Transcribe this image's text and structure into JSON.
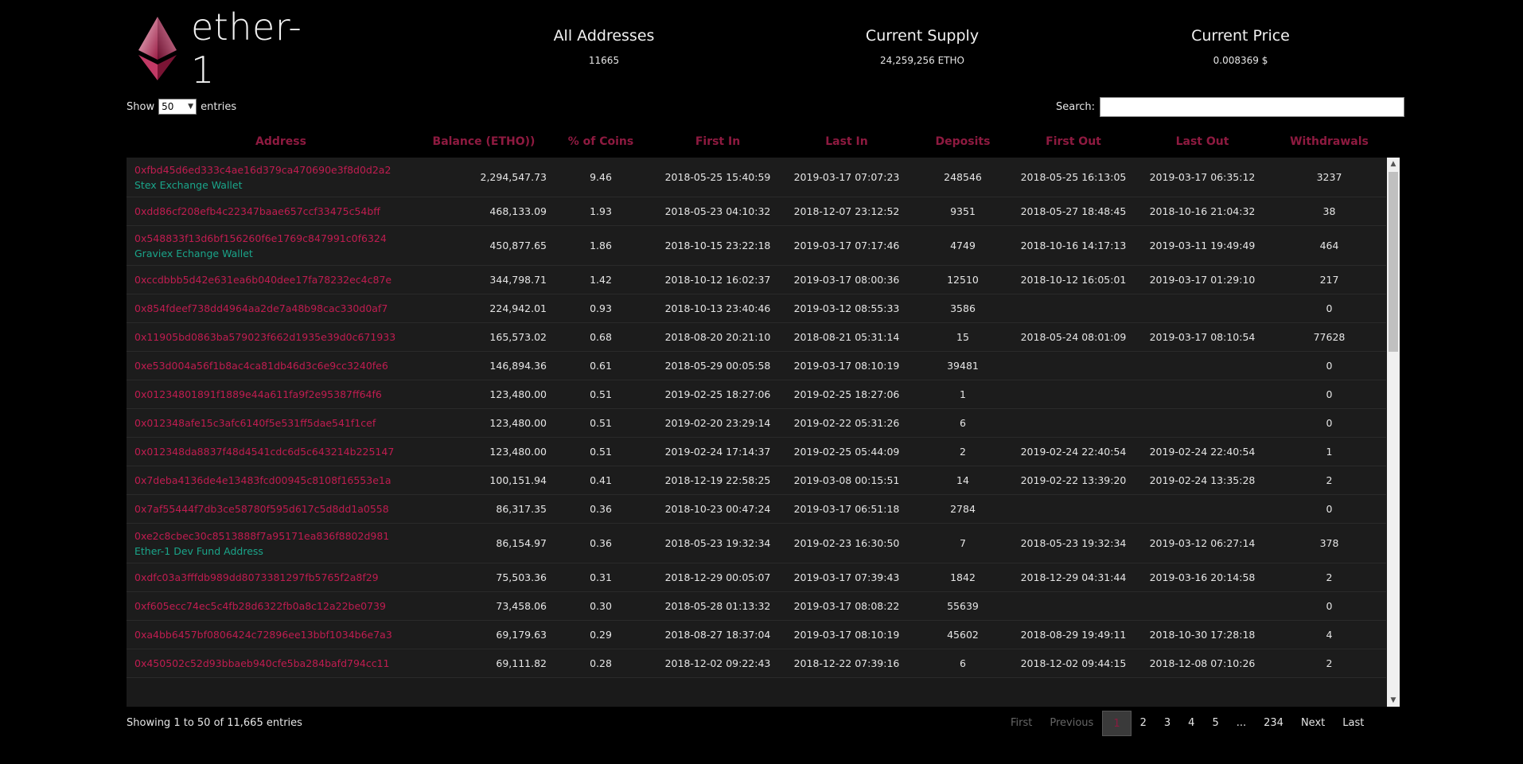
{
  "header": {
    "logo_text": "ether-1",
    "stats": [
      {
        "title": "All Addresses",
        "value": "11665"
      },
      {
        "title": "Current Supply",
        "value": "24,259,256 ETHO"
      },
      {
        "title": "Current Price",
        "value": "0.008369 $"
      }
    ]
  },
  "controls": {
    "show_label": "Show",
    "page_size": "50",
    "entries_label": "entries",
    "search_label": "Search:",
    "search_value": ""
  },
  "table": {
    "columns": [
      "Address",
      "Balance (ETHO))",
      "% of Coins",
      "First In",
      "Last In",
      "Deposits",
      "First Out",
      "Last Out",
      "Withdrawals"
    ],
    "rows": [
      {
        "address": "0xfbd45d6ed333c4ae16d379ca470690e3f8d0d2a2",
        "tag": "Stex Exchange Wallet",
        "balance": "2,294,547.73",
        "pct": "9.46",
        "first_in": "2018-05-25 15:40:59",
        "last_in": "2019-03-17 07:07:23",
        "deposits": "248546",
        "first_out": "2018-05-25 16:13:05",
        "last_out": "2019-03-17 06:35:12",
        "withdrawals": "3237"
      },
      {
        "address": "0xdd86cf208efb4c22347baae657ccf33475c54bff",
        "tag": "",
        "balance": "468,133.09",
        "pct": "1.93",
        "first_in": "2018-05-23 04:10:32",
        "last_in": "2018-12-07 23:12:52",
        "deposits": "9351",
        "first_out": "2018-05-27 18:48:45",
        "last_out": "2018-10-16 21:04:32",
        "withdrawals": "38"
      },
      {
        "address": "0x548833f13d6bf156260f6e1769c847991c0f6324",
        "tag": "Graviex Echange Wallet",
        "balance": "450,877.65",
        "pct": "1.86",
        "first_in": "2018-10-15 23:22:18",
        "last_in": "2019-03-17 07:17:46",
        "deposits": "4749",
        "first_out": "2018-10-16 14:17:13",
        "last_out": "2019-03-11 19:49:49",
        "withdrawals": "464"
      },
      {
        "address": "0xccdbbb5d42e631ea6b040dee17fa78232ec4c87e",
        "tag": "",
        "balance": "344,798.71",
        "pct": "1.42",
        "first_in": "2018-10-12 16:02:37",
        "last_in": "2019-03-17 08:00:36",
        "deposits": "12510",
        "first_out": "2018-10-12 16:05:01",
        "last_out": "2019-03-17 01:29:10",
        "withdrawals": "217"
      },
      {
        "address": "0x854fdeef738dd4964aa2de7a48b98cac330d0af7",
        "tag": "",
        "balance": "224,942.01",
        "pct": "0.93",
        "first_in": "2018-10-13 23:40:46",
        "last_in": "2019-03-12 08:55:33",
        "deposits": "3586",
        "first_out": "",
        "last_out": "",
        "withdrawals": "0"
      },
      {
        "address": "0x11905bd0863ba579023f662d1935e39d0c671933",
        "tag": "",
        "balance": "165,573.02",
        "pct": "0.68",
        "first_in": "2018-08-20 20:21:10",
        "last_in": "2018-08-21 05:31:14",
        "deposits": "15",
        "first_out": "2018-05-24 08:01:09",
        "last_out": "2019-03-17 08:10:54",
        "withdrawals": "77628"
      },
      {
        "address": "0xe53d004a56f1b8ac4ca81db46d3c6e9cc3240fe6",
        "tag": "",
        "balance": "146,894.36",
        "pct": "0.61",
        "first_in": "2018-05-29 00:05:58",
        "last_in": "2019-03-17 08:10:19",
        "deposits": "39481",
        "first_out": "",
        "last_out": "",
        "withdrawals": "0"
      },
      {
        "address": "0x01234801891f1889e44a611fa9f2e95387ff64f6",
        "tag": "",
        "balance": "123,480.00",
        "pct": "0.51",
        "first_in": "2019-02-25 18:27:06",
        "last_in": "2019-02-25 18:27:06",
        "deposits": "1",
        "first_out": "",
        "last_out": "",
        "withdrawals": "0"
      },
      {
        "address": "0x012348afe15c3afc6140f5e531ff5dae541f1cef",
        "tag": "",
        "balance": "123,480.00",
        "pct": "0.51",
        "first_in": "2019-02-20 23:29:14",
        "last_in": "2019-02-22 05:31:26",
        "deposits": "6",
        "first_out": "",
        "last_out": "",
        "withdrawals": "0"
      },
      {
        "address": "0x012348da8837f48d4541cdc6d5c643214b225147",
        "tag": "",
        "balance": "123,480.00",
        "pct": "0.51",
        "first_in": "2019-02-24 17:14:37",
        "last_in": "2019-02-25 05:44:09",
        "deposits": "2",
        "first_out": "2019-02-24 22:40:54",
        "last_out": "2019-02-24 22:40:54",
        "withdrawals": "1"
      },
      {
        "address": "0x7deba4136de4e13483fcd00945c8108f16553e1a",
        "tag": "",
        "balance": "100,151.94",
        "pct": "0.41",
        "first_in": "2018-12-19 22:58:25",
        "last_in": "2019-03-08 00:15:51",
        "deposits": "14",
        "first_out": "2019-02-22 13:39:20",
        "last_out": "2019-02-24 13:35:28",
        "withdrawals": "2"
      },
      {
        "address": "0x7af55444f7db3ce58780f595d617c5d8dd1a0558",
        "tag": "",
        "balance": "86,317.35",
        "pct": "0.36",
        "first_in": "2018-10-23 00:47:24",
        "last_in": "2019-03-17 06:51:18",
        "deposits": "2784",
        "first_out": "",
        "last_out": "",
        "withdrawals": "0"
      },
      {
        "address": "0xe2c8cbec30c8513888f7a95171ea836f8802d981",
        "tag": "Ether-1 Dev Fund Address",
        "balance": "86,154.97",
        "pct": "0.36",
        "first_in": "2018-05-23 19:32:34",
        "last_in": "2019-02-23 16:30:50",
        "deposits": "7",
        "first_out": "2018-05-23 19:32:34",
        "last_out": "2019-03-12 06:27:14",
        "withdrawals": "378"
      },
      {
        "address": "0xdfc03a3fffdb989dd8073381297fb5765f2a8f29",
        "tag": "",
        "balance": "75,503.36",
        "pct": "0.31",
        "first_in": "2018-12-29 00:05:07",
        "last_in": "2019-03-17 07:39:43",
        "deposits": "1842",
        "first_out": "2018-12-29 04:31:44",
        "last_out": "2019-03-16 20:14:58",
        "withdrawals": "2"
      },
      {
        "address": "0xf605ecc74ec5c4fb28d6322fb0a8c12a22be0739",
        "tag": "",
        "balance": "73,458.06",
        "pct": "0.30",
        "first_in": "2018-05-28 01:13:32",
        "last_in": "2019-03-17 08:08:22",
        "deposits": "55639",
        "first_out": "",
        "last_out": "",
        "withdrawals": "0"
      },
      {
        "address": "0xa4bb6457bf0806424c72896ee13bbf1034b6e7a3",
        "tag": "",
        "balance": "69,179.63",
        "pct": "0.29",
        "first_in": "2018-08-27 18:37:04",
        "last_in": "2019-03-17 08:10:19",
        "deposits": "45602",
        "first_out": "2018-08-29 19:49:11",
        "last_out": "2018-10-30 17:28:18",
        "withdrawals": "4"
      },
      {
        "address": "0x450502c52d93bbaeb940cfe5ba284bafd794cc11",
        "tag": "",
        "balance": "69,111.82",
        "pct": "0.28",
        "first_in": "2018-12-02 09:22:43",
        "last_in": "2018-12-22 07:39:16",
        "deposits": "6",
        "first_out": "2018-12-02 09:44:15",
        "last_out": "2018-12-08 07:10:26",
        "withdrawals": "2"
      }
    ]
  },
  "footer": {
    "showing_text": "Showing 1 to 50 of 11,665 entries",
    "pagination": [
      {
        "label": "First",
        "state": "disabled"
      },
      {
        "label": "Previous",
        "state": "disabled"
      },
      {
        "label": "1",
        "state": "current"
      },
      {
        "label": "2",
        "state": "normal"
      },
      {
        "label": "3",
        "state": "normal"
      },
      {
        "label": "4",
        "state": "normal"
      },
      {
        "label": "5",
        "state": "normal"
      },
      {
        "label": "...",
        "state": "ellipsis"
      },
      {
        "label": "234",
        "state": "normal"
      },
      {
        "label": "Next",
        "state": "normal"
      },
      {
        "label": "Last",
        "state": "normal"
      }
    ]
  },
  "colors": {
    "accent": "#8e1a40",
    "link": "#c01c50",
    "tag": "#1aa58a",
    "background": "#000000",
    "table_bg": "#1c1c1c"
  },
  "icons": {
    "logo": "ethereum-diamond-icon",
    "select_arrow": "chevron-down-icon",
    "scroll_up": "arrow-up-icon",
    "scroll_down": "arrow-down-icon"
  }
}
